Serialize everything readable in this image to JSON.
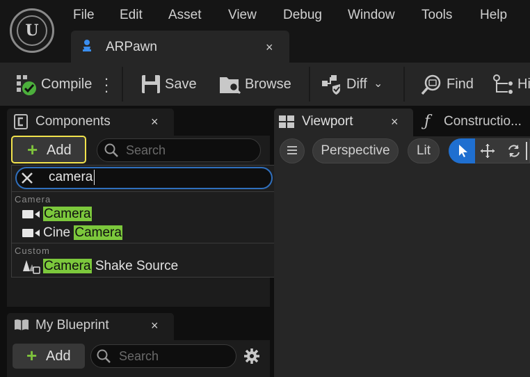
{
  "app": {
    "logo": "unreal-engine-logo"
  },
  "menu": [
    "File",
    "Edit",
    "Asset",
    "View",
    "Debug",
    "Window",
    "Tools",
    "Help"
  ],
  "document_tab": {
    "label": "ARPawn",
    "close": "×",
    "icon": "pawn-icon"
  },
  "toolbar": {
    "compile": "Compile",
    "save": "Save",
    "browse": "Browse",
    "diff": "Diff",
    "find": "Find",
    "hierarchy": "Hi"
  },
  "components_panel": {
    "title": "Components",
    "close": "×",
    "add_label": "Add",
    "search_placeholder": "Search"
  },
  "add_dropdown": {
    "search_value": "camera",
    "categories": [
      {
        "name": "Camera",
        "items": [
          {
            "prefix": "",
            "match": "Camera",
            "suffix": "",
            "icon": "camera-icon"
          },
          {
            "prefix": "Cine ",
            "match": "Camera",
            "suffix": "",
            "icon": "camera-icon"
          }
        ]
      },
      {
        "name": "Custom",
        "items": [
          {
            "prefix": "",
            "match": "Camera",
            "suffix": " Shake Source",
            "icon": "camera-shake-icon"
          }
        ]
      }
    ]
  },
  "viewport": {
    "tab_label": "Viewport",
    "close": "×",
    "construction_tab": "Construction Script",
    "construction_tab_display": "Constructio...",
    "perspective": "Perspective",
    "lit": "Lit"
  },
  "my_blueprint": {
    "title": "My Blueprint",
    "close": "×",
    "add_label": "Add",
    "search_placeholder": "Search"
  },
  "colors": {
    "accent_green": "#7cc83c",
    "focus_yellow": "#f2e34c",
    "focus_blue": "#2f6fbd",
    "select_blue": "#1f6fd0"
  }
}
